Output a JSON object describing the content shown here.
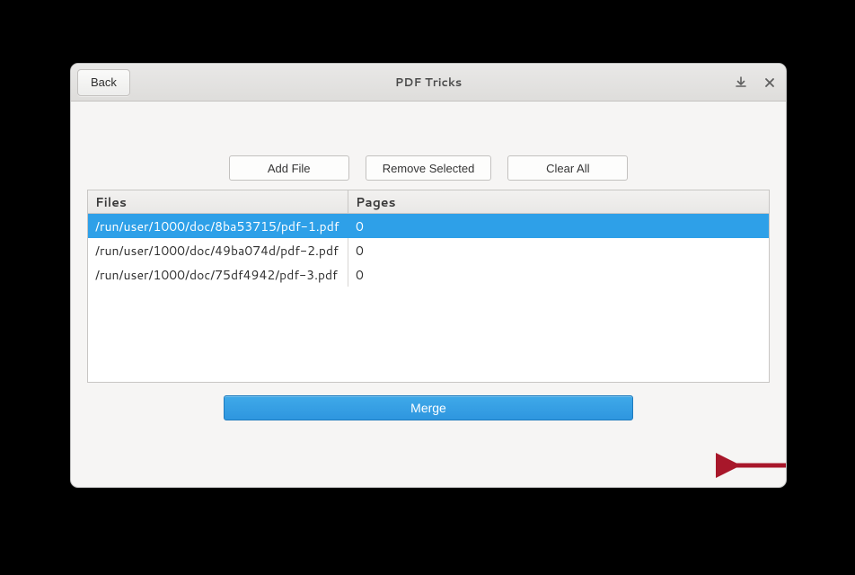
{
  "header": {
    "back_label": "Back",
    "title": "PDF Tricks"
  },
  "toolbar": {
    "add_file_label": "Add File",
    "remove_selected_label": "Remove Selected",
    "clear_all_label": "Clear All"
  },
  "table": {
    "columns": {
      "files": "Files",
      "pages": "Pages"
    },
    "rows": [
      {
        "file": "/run/user/1000/doc/8ba53715/pdf-1.pdf",
        "pages": "0",
        "selected": true
      },
      {
        "file": "/run/user/1000/doc/49ba074d/pdf-2.pdf",
        "pages": "0",
        "selected": false
      },
      {
        "file": "/run/user/1000/doc/75df4942/pdf-3.pdf",
        "pages": "0",
        "selected": false
      }
    ]
  },
  "actions": {
    "merge_label": "Merge"
  },
  "annotation": {
    "arrow_color": "#a8172a"
  }
}
